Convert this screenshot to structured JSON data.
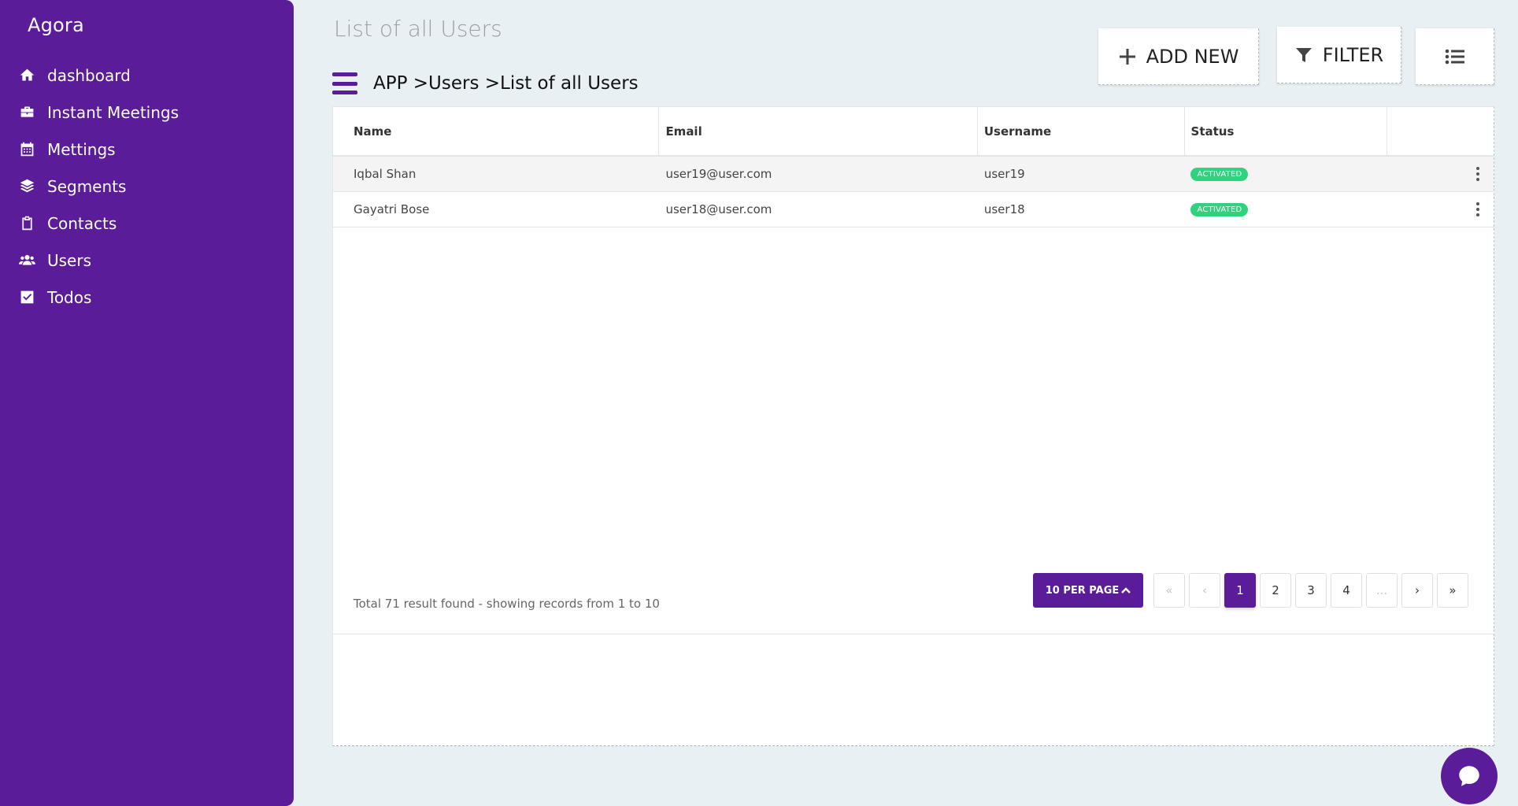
{
  "app": {
    "brand": "Agora"
  },
  "sidebar": {
    "items": [
      {
        "label": "dashboard",
        "icon": "home-icon"
      },
      {
        "label": "Instant Meetings",
        "icon": "briefcase-icon"
      },
      {
        "label": "Mettings",
        "icon": "calendar-icon"
      },
      {
        "label": "Segments",
        "icon": "layers-icon"
      },
      {
        "label": "Contacts",
        "icon": "clipboard-icon"
      },
      {
        "label": "Users",
        "icon": "users-icon"
      },
      {
        "label": "Todos",
        "icon": "check-square-icon"
      }
    ]
  },
  "header": {
    "title": "List of all Users",
    "breadcrumb": "APP >Users >List of all Users",
    "add_label": "ADD NEW",
    "filter_label": "FILTER"
  },
  "table": {
    "columns": [
      "Name",
      "Email",
      "Username",
      "Status"
    ],
    "rows": [
      {
        "name": "Iqbal Shan",
        "email": "user19@user.com",
        "username": "user19",
        "status": "ACTIVATED"
      },
      {
        "name": "Gayatri Bose",
        "email": "user18@user.com",
        "username": "user18",
        "status": "ACTIVATED"
      }
    ]
  },
  "footer": {
    "total_text": "Total 71 result found - showing records from 1 to 10",
    "per_page_label": "10 PER PAGE",
    "pages": [
      "«",
      "‹",
      "1",
      "2",
      "3",
      "4",
      "...",
      "›",
      "»"
    ],
    "current_page": "1"
  },
  "colors": {
    "accent": "#5a1c98",
    "badge": "#2fd27d",
    "background": "#e9f0f3"
  }
}
